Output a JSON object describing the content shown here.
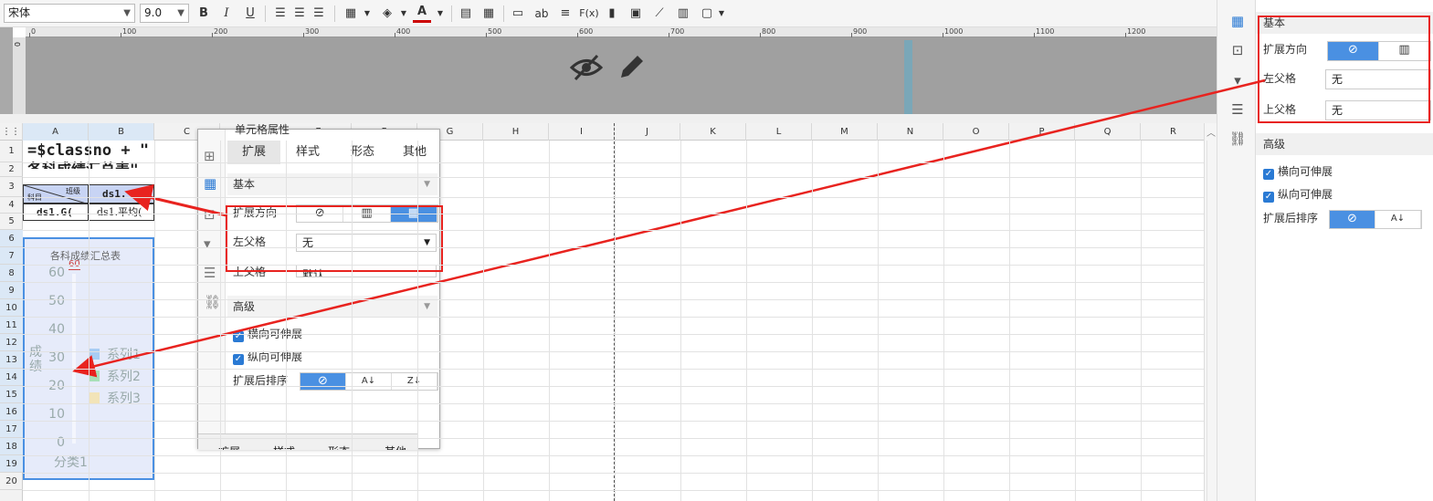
{
  "toolbar": {
    "font_family": "宋体",
    "font_size": "9.0",
    "bold": "B",
    "italic": "I",
    "underline": "U",
    "text_tool": "ab",
    "formula_tool": "F(x)"
  },
  "ruler": {
    "ticks": [
      "0",
      "100",
      "200",
      "300",
      "400",
      "500",
      "600",
      "700",
      "800",
      "900",
      "1000",
      "1100",
      "1200"
    ],
    "vertical_zero": "0"
  },
  "grid": {
    "columns": [
      "A",
      "B",
      "C",
      "D",
      "E",
      "F",
      "G",
      "H",
      "I",
      "J",
      "K",
      "L",
      "M",
      "N",
      "O",
      "P",
      "Q",
      "R"
    ],
    "rows": [
      "1",
      "2",
      "3",
      "4",
      "5",
      "6",
      "7",
      "8",
      "9",
      "10",
      "11",
      "12",
      "13",
      "14",
      "15",
      "16",
      "17",
      "18",
      "19",
      "20"
    ],
    "cells": {
      "a1": "=$classno + \"",
      "a2": "各科成绩汇总表\"",
      "a3_top": "班级",
      "a3_bottom": "科目",
      "b3": "ds1.",
      "a4": "ds1.G(",
      "b4": "ds1.平均("
    }
  },
  "chart_data": {
    "type": "bar",
    "title": "各科成绩汇总表",
    "ylabel": "成绩",
    "xlabel": "",
    "categories": [
      "分类1"
    ],
    "yticks": [
      "0",
      "10",
      "20",
      "30",
      "40",
      "50",
      "60"
    ],
    "ylim": [
      0,
      60
    ],
    "series": [
      {
        "name": "系列1",
        "values": [
          60
        ],
        "value_label": "60",
        "color": "#a8cdf4"
      },
      {
        "name": "系列2",
        "values": [
          0
        ],
        "color": "#a8e0b8"
      },
      {
        "name": "系列3",
        "values": [
          0
        ],
        "color": "#f2e4b8"
      }
    ]
  },
  "dialog": {
    "title": "单元格属性",
    "tabs": [
      "扩展",
      "样式",
      "形态",
      "其他"
    ],
    "section_basic": "基本",
    "expand_direction_label": "扩展方向",
    "left_parent_label": "左父格",
    "left_parent_value": "无",
    "top_parent_label": "上父格",
    "top_parent_value": "默认",
    "section_advanced": "高级",
    "horizontal_expand": "横向可伸展",
    "vertical_expand": "纵向可伸展",
    "sort_label": "扩展后排序",
    "bottom_tabs": [
      "扩展",
      "样式",
      "形态",
      "其他"
    ]
  },
  "right_panel": {
    "section_basic": "基本",
    "expand_direction_label": "扩展方向",
    "left_parent_label": "左父格",
    "left_parent_value": "无",
    "top_parent_label": "上父格",
    "top_parent_value": "无",
    "section_advanced": "高级",
    "horizontal_expand": "横向可伸展",
    "vertical_expand": "纵向可伸展",
    "sort_label": "扩展后排序"
  },
  "colors": {
    "accent": "#4a90e2",
    "annotation": "#e8231f"
  }
}
